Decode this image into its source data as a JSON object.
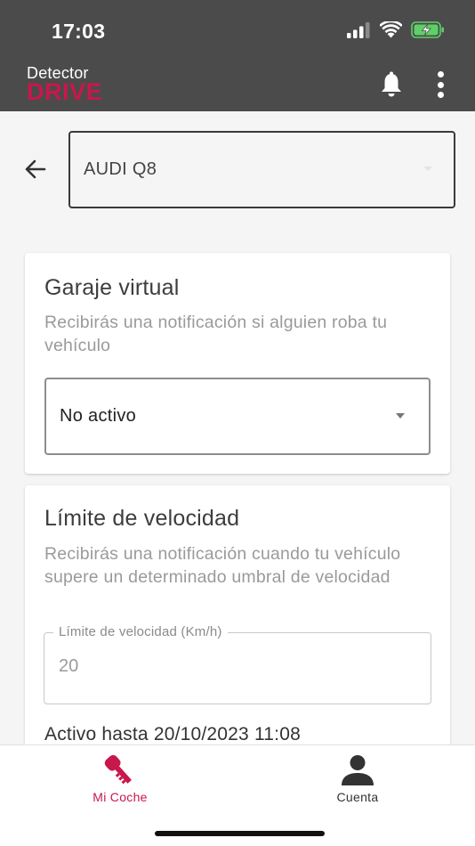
{
  "status_bar": {
    "time": "17:03"
  },
  "app_bar": {
    "logo_top": "Detector",
    "logo_bottom": "DRIVE"
  },
  "vehicle": {
    "selected": "AUDI Q8"
  },
  "garaje": {
    "title": "Garaje virtual",
    "description": "Recibirás una notificación si alguien roba tu vehículo",
    "selected": "No activo"
  },
  "limite": {
    "title": "Límite de velocidad",
    "description": "Recibirás una notificación cuando tu vehículo supere un determinado umbral de velocidad",
    "field_label": "Límite de velocidad (Km/h)",
    "field_value": "20",
    "active_until": "Activo hasta 20/10/2023 11:08"
  },
  "bottom_nav": {
    "items": [
      {
        "label": "Mi Coche",
        "icon": "car-key-icon",
        "active": true
      },
      {
        "label": "Cuenta",
        "icon": "account-icon",
        "active": false
      }
    ]
  },
  "colors": {
    "brand": "#c8174b",
    "appbar": "#4b4b4b",
    "battery": "#5fd068"
  }
}
